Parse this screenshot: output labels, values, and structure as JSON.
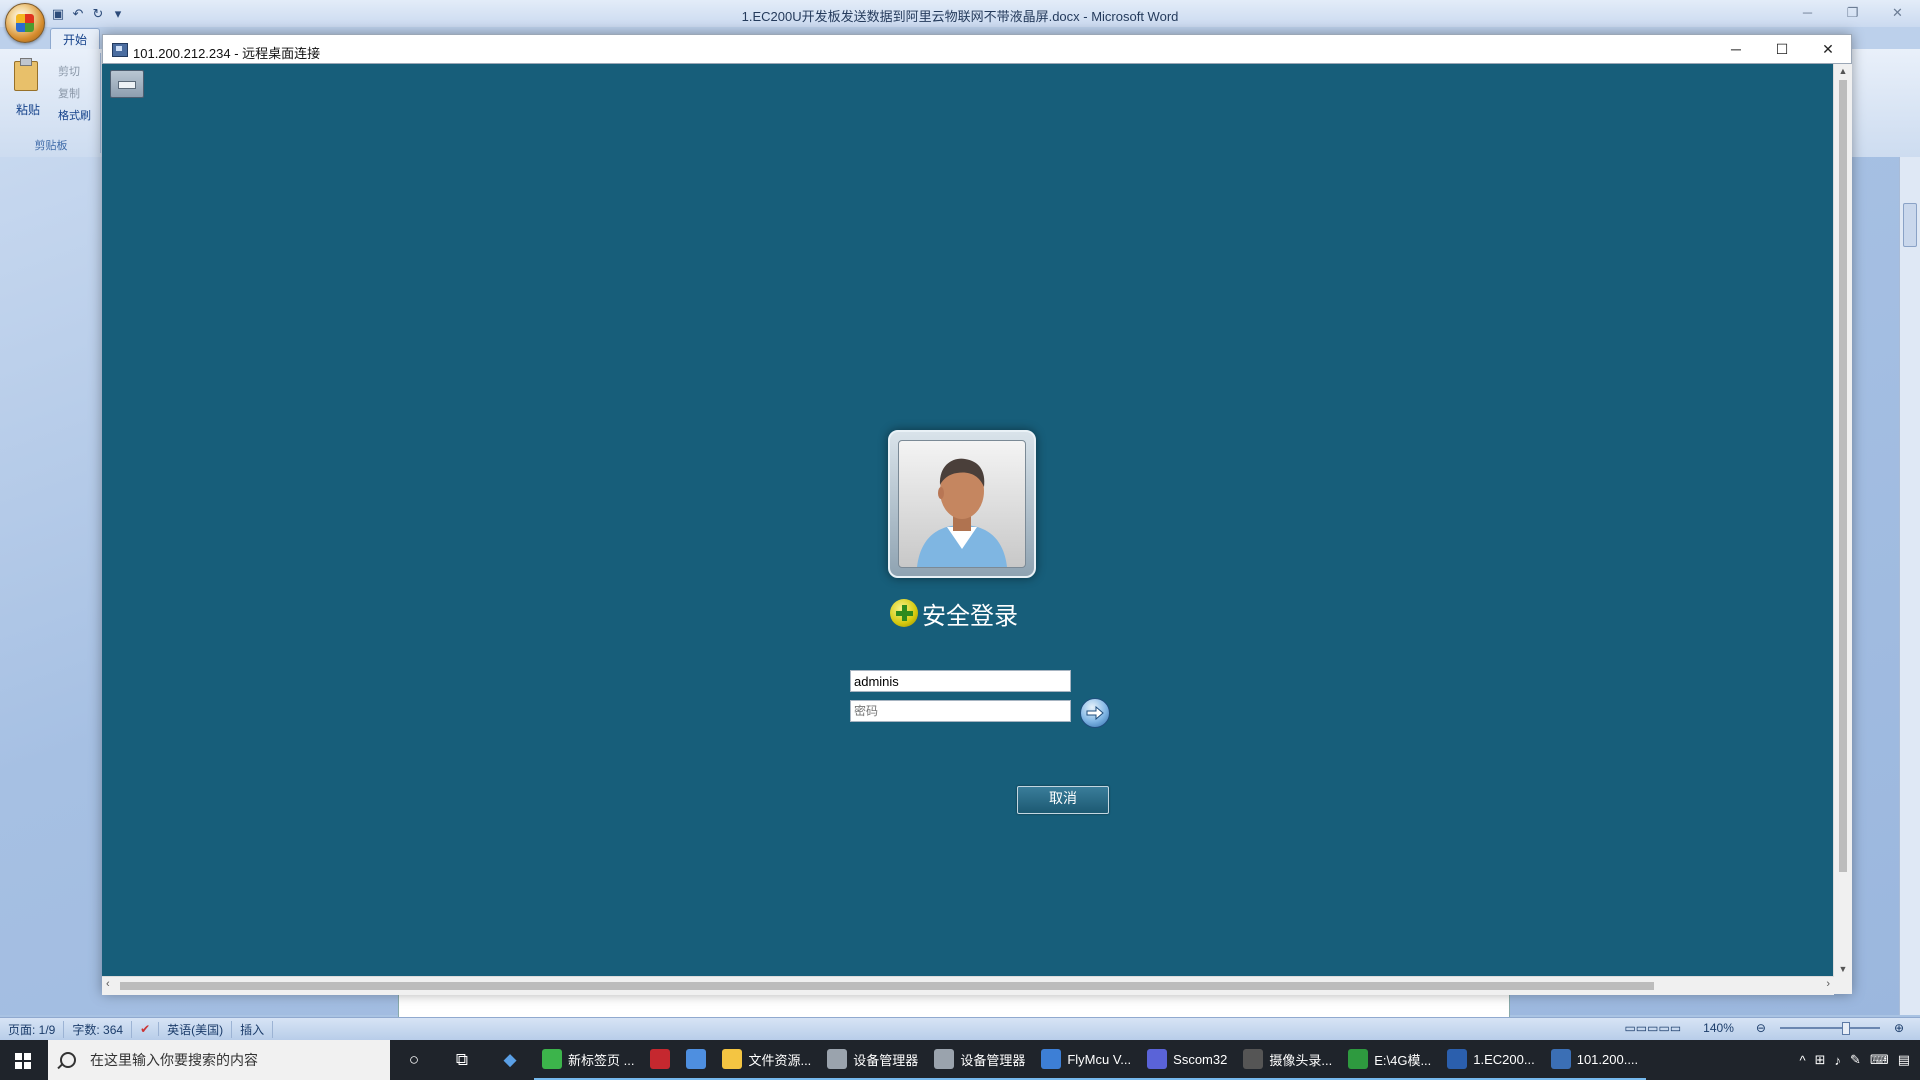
{
  "word": {
    "title": "1.EC200U开发板发送数据到阿里云物联网不带液晶屏.docx - Microsoft Word",
    "tab_home": "开始",
    "clipboard": {
      "paste": "粘贴",
      "cut": "剪切",
      "copy": "复制",
      "format_painter": "格式刷",
      "group_label": "剪贴板"
    },
    "status": {
      "page": "页面: 1/9",
      "words": "字数: 364",
      "language": "英语(美国)",
      "mode": "插入",
      "zoom": "140%"
    }
  },
  "rdp": {
    "title": "101.200.212.234 - 远程桌面连接",
    "login": {
      "title": "安全登录",
      "username_value": "adminis",
      "password_placeholder": "密码",
      "cancel_label": "取消"
    }
  },
  "taskbar": {
    "search_placeholder": "在这里输入你要搜索的内容",
    "apps": [
      {
        "label": "新标签页 ...",
        "color": "#3cb44b"
      },
      {
        "label": "",
        "color": "#c5282f"
      },
      {
        "label": "",
        "color": "#4e8fe0"
      },
      {
        "label": "文件资源...",
        "color": "#f4c542"
      },
      {
        "label": "设备管理器",
        "color": "#9aa3ad"
      },
      {
        "label": "设备管理器",
        "color": "#9aa3ad"
      },
      {
        "label": "FlyMcu V...",
        "color": "#3d7fd6"
      },
      {
        "label": "Sscom32",
        "color": "#5a63d8"
      },
      {
        "label": "摄像头录...",
        "color": "#555555"
      },
      {
        "label": "E:\\4G模...",
        "color": "#2e9a3f"
      },
      {
        "label": "1.EC200...",
        "color": "#2b5fad"
      },
      {
        "label": "101.200....",
        "color": "#3b6fb5"
      }
    ]
  }
}
